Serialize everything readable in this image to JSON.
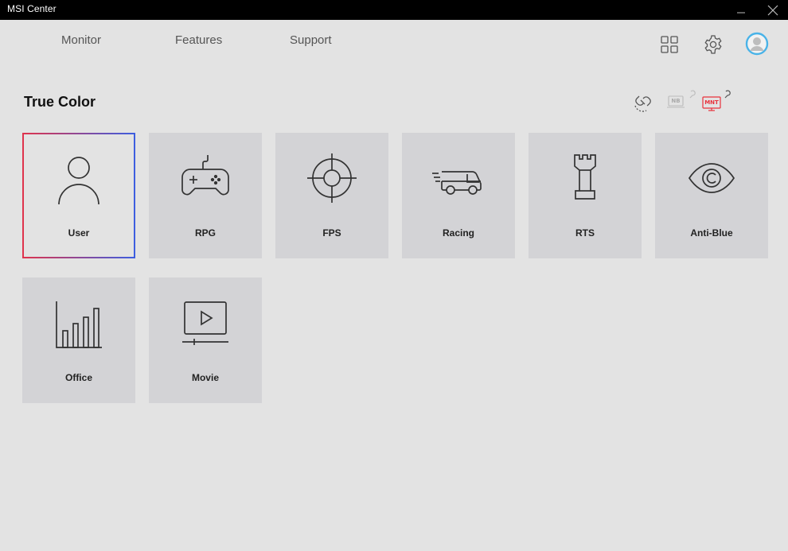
{
  "window": {
    "title": "MSI Center",
    "minimize_icon": "minimize-icon",
    "close_icon": "close-icon"
  },
  "nav": {
    "items": [
      {
        "label": "Monitor"
      },
      {
        "label": "Features"
      },
      {
        "label": "Support"
      }
    ]
  },
  "toolbar": {
    "icons": [
      "grid-icon",
      "gear-icon",
      "avatar-icon"
    ]
  },
  "page": {
    "title": "True Color"
  },
  "devices": {
    "items": [
      {
        "icon": "link-icon"
      },
      {
        "label": "NB",
        "icon": "notebook-icon"
      },
      {
        "label": "MNT",
        "icon": "monitor-icon",
        "color": "#e8323c"
      }
    ]
  },
  "modes": {
    "selected": "User",
    "items": [
      {
        "label": "User",
        "icon": "user-icon"
      },
      {
        "label": "RPG",
        "icon": "gamepad-icon"
      },
      {
        "label": "FPS",
        "icon": "crosshair-icon"
      },
      {
        "label": "Racing",
        "icon": "van-icon"
      },
      {
        "label": "RTS",
        "icon": "chess-rook-icon"
      },
      {
        "label": "Anti-Blue",
        "icon": "eye-icon"
      },
      {
        "label": "Office",
        "icon": "bar-chart-icon"
      },
      {
        "label": "Movie",
        "icon": "play-screen-icon"
      }
    ]
  },
  "colors": {
    "background": "#e3e3e3",
    "tile": "#d3d3d6",
    "titlebar": "#000000",
    "selection_red": "#e0334c",
    "selection_blue": "#3c5ee0",
    "avatar_ring": "#49b3e8"
  }
}
